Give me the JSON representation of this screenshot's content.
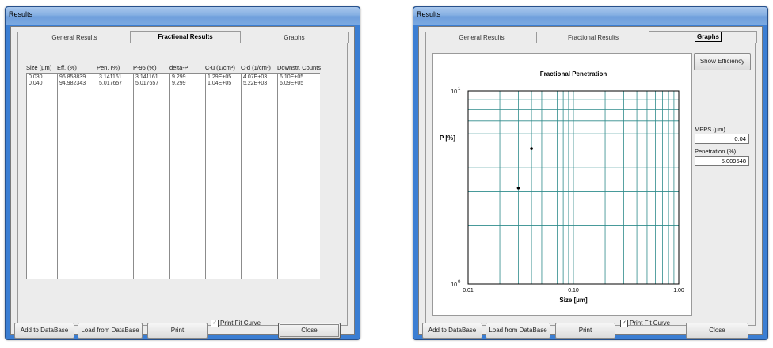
{
  "window1": {
    "title": "Results",
    "tabs": [
      "General Results",
      "Fractional Results",
      "Graphs"
    ],
    "table": {
      "headers": [
        "Size (µm)",
        "Eff. (%)",
        "Pen. (%)",
        "P-95 (%)",
        "delta-P",
        "C-u (1/cm³)",
        "C-d (1/cm³)",
        "Downstr. Counts"
      ],
      "rows": [
        [
          "0.030",
          "96.858839",
          "3.141161",
          "3.141161",
          "9.299",
          "1.29E+05",
          "4.07E+03",
          "6.10E+05"
        ],
        [
          "0.040",
          "94.982343",
          "5.017657",
          "5.017657",
          "9.299",
          "1.04E+05",
          "5.22E+03",
          "6.09E+05"
        ]
      ]
    },
    "buttons": {
      "add": "Add to DataBase",
      "load": "Load from DataBase",
      "print": "Print",
      "print_fit": "Print Fit Curve",
      "close": "Close"
    }
  },
  "window2": {
    "title": "Results",
    "tabs": [
      "General Results",
      "Fractional Results",
      "Graphs"
    ],
    "show_efficiency": "Show Efficiency",
    "mpps_label": "MPPS (µm)",
    "mpps_value": "0.04",
    "pen_label": "Penetration (%)",
    "pen_value": "5.009548",
    "buttons": {
      "add": "Add to DataBase",
      "load": "Load from DataBase",
      "print": "Print",
      "print_fit": "Print Fit Curve",
      "close": "Close"
    }
  },
  "chart_data": {
    "type": "scatter",
    "title": "Fractional Penetration",
    "xlabel": "Size [µm]",
    "ylabel": "P [%]",
    "x_scale": "log",
    "y_scale": "log",
    "xlim": [
      0.01,
      1.0
    ],
    "ylim": [
      1,
      10
    ],
    "x_tick_labels": [
      "0.01",
      "0.10",
      "1.00"
    ],
    "y_tick_labels": [
      {
        "base": "10",
        "exp": "0"
      },
      {
        "base": "10",
        "exp": "1"
      }
    ],
    "grid": true,
    "points": [
      {
        "x": 0.03,
        "y": 3.14
      },
      {
        "x": 0.04,
        "y": 5.02
      }
    ],
    "colors": {
      "grid": "#2e8b8b",
      "frame": "#000000",
      "point": "#000000"
    }
  }
}
